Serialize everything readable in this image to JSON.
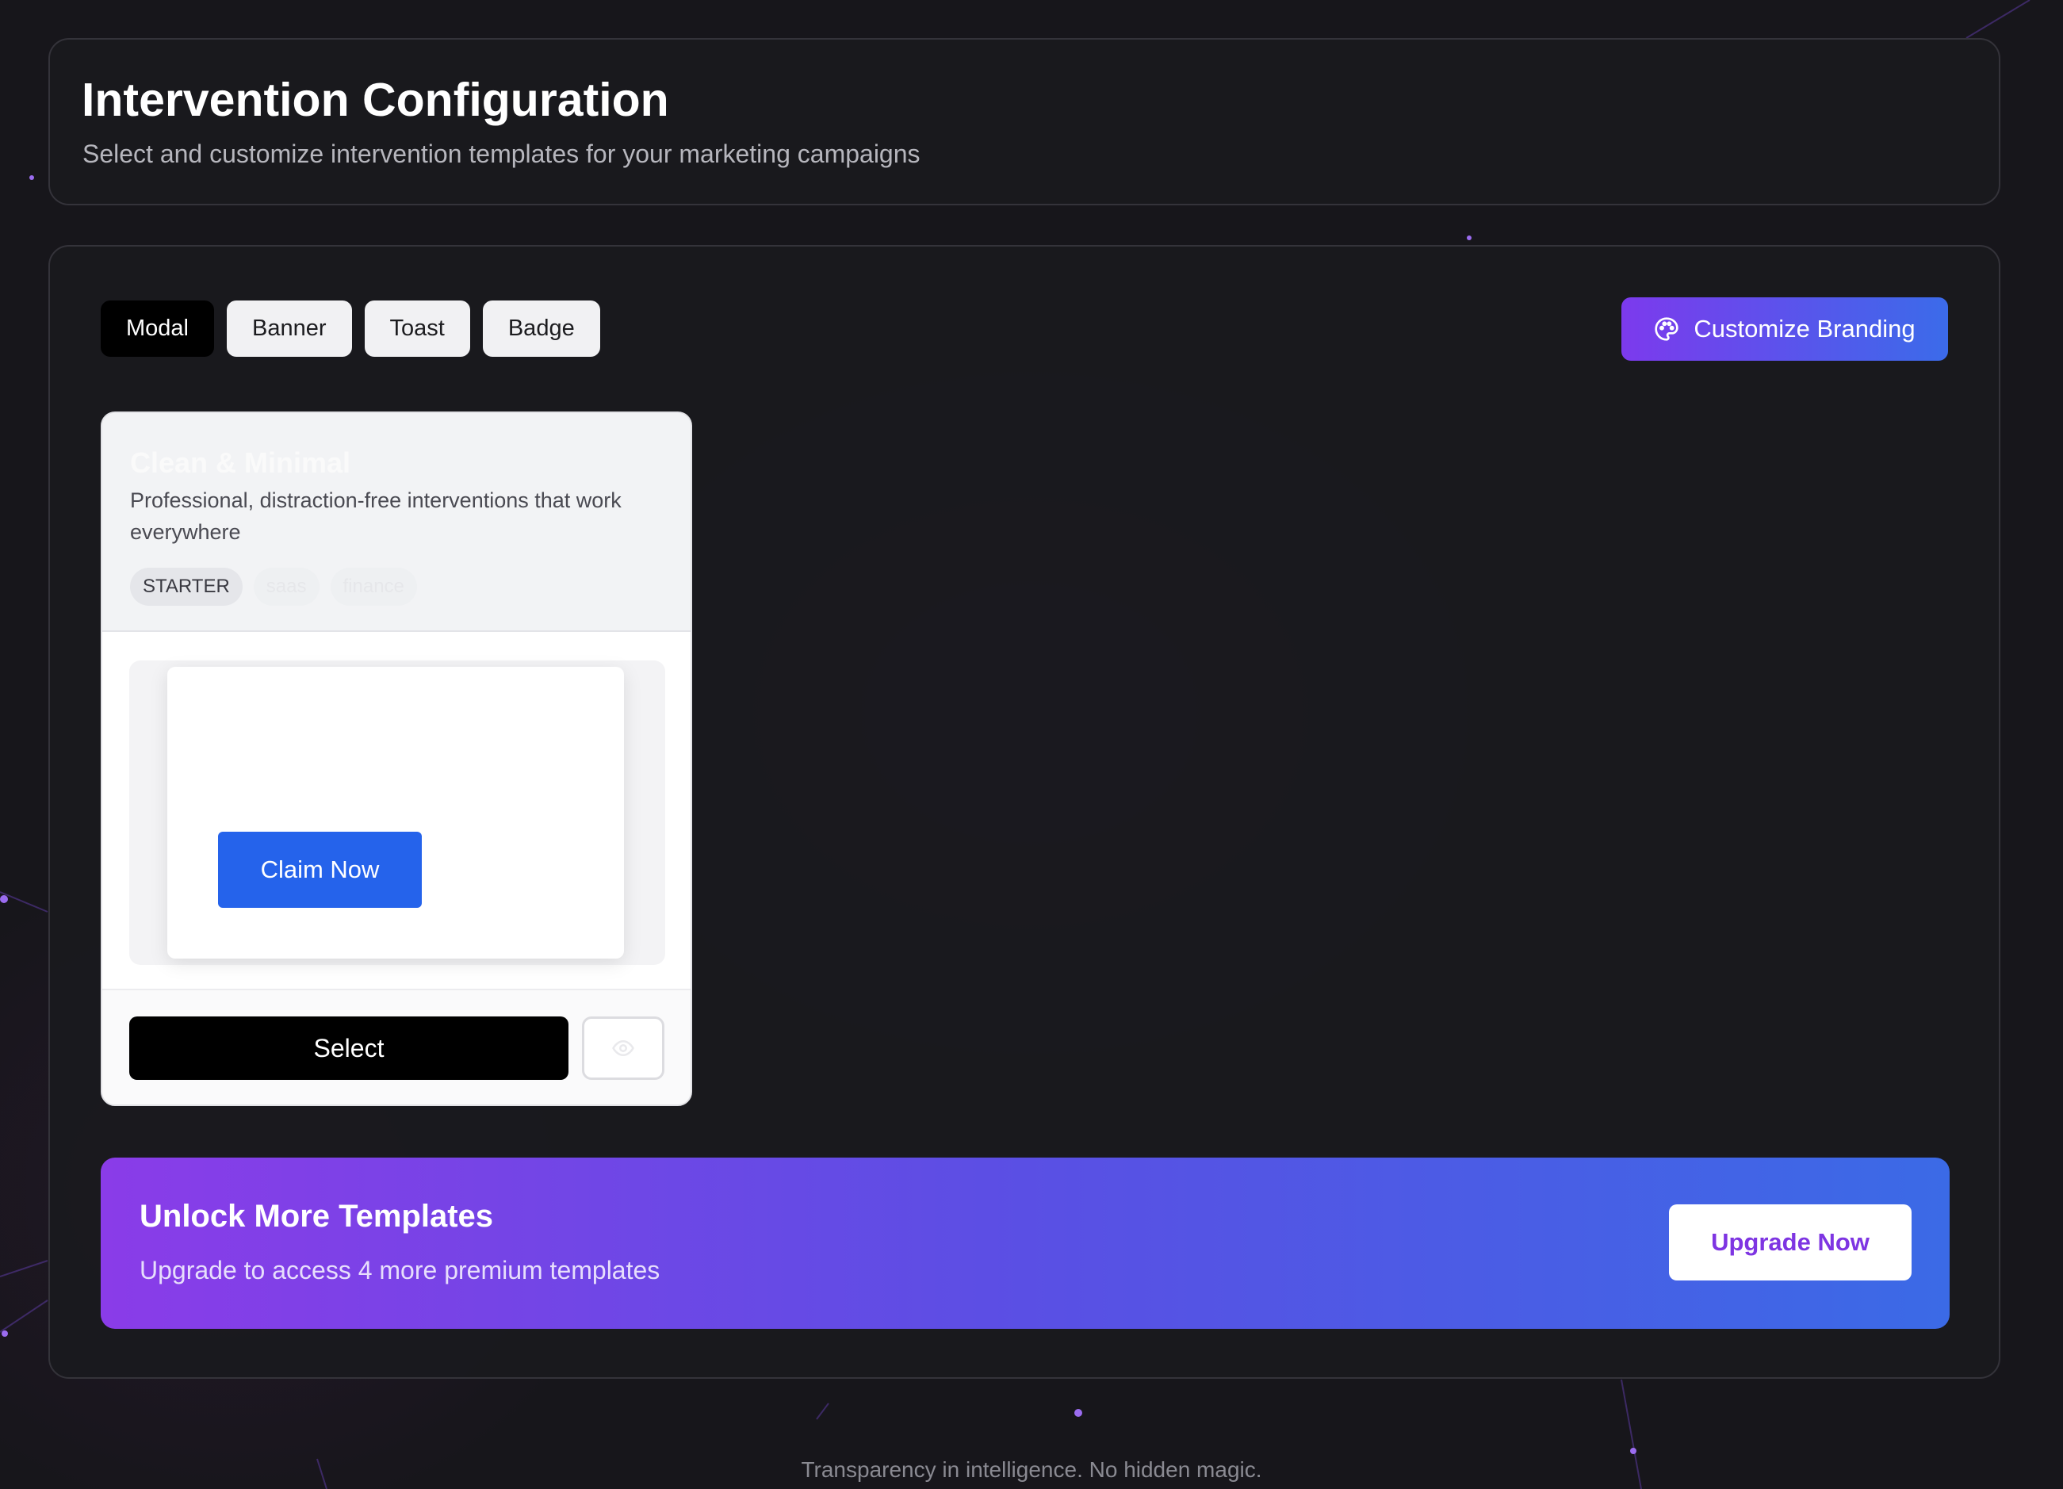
{
  "header": {
    "title": "Intervention Configuration",
    "subtitle": "Select and customize intervention templates for your marketing campaigns"
  },
  "tabs": [
    {
      "label": "Modal",
      "active": true
    },
    {
      "label": "Banner",
      "active": false
    },
    {
      "label": "Toast",
      "active": false
    },
    {
      "label": "Badge",
      "active": false
    }
  ],
  "branding_button": {
    "label": "Customize Branding",
    "icon": "palette-icon"
  },
  "template": {
    "name": "Clean & Minimal",
    "description": "Professional, distraction-free interventions that work everywhere",
    "tags": [
      "STARTER",
      "saas",
      "finance"
    ],
    "preview_cta": "Claim Now",
    "select_label": "Select",
    "preview_icon": "eye-icon"
  },
  "upgrade": {
    "title": "Unlock More Templates",
    "subtitle": "Upgrade to access 4 more premium templates",
    "button": "Upgrade Now"
  },
  "footer": {
    "text": "Transparency in intelligence. No hidden magic."
  },
  "colors": {
    "accent_gradient_start": "#7c3aed",
    "accent_gradient_end": "#3b6bea",
    "cta_blue": "#2563eb",
    "background": "#17161b"
  }
}
